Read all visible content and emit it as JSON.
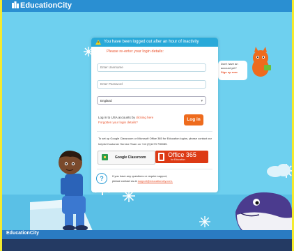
{
  "header": {
    "logo_text": "EducationCity",
    "bg_color": "#2a8fd2"
  },
  "login_card": {
    "alert_text": "You have been logged out after an hour of inactivity",
    "alert_icon": "warning-icon",
    "prompt": "Please re-enter your login details:",
    "username_placeholder": "Enter Username",
    "password_placeholder": "Enter Password",
    "region_selected": "England",
    "usa_text": "Log in to USA accounts by",
    "usa_link": "clicking here",
    "forgot_link": "Forgotten your login details?",
    "login_button": "Log in",
    "classroom_note": "To set up Google Classroom or Microsoft Office 365 for Education logins, please contact our helpful Customer Service Team on +44 (0)1473 735085.",
    "google_button": "Google Classroom",
    "office_title": "Office 365",
    "office_subtitle": "for Education",
    "help_line1": "If you have any questions or require support,",
    "help_line2_prefix": "please contact us at",
    "help_email": "support@educationcity.com."
  },
  "signup_bubble": {
    "text": "Don't have an account yet?",
    "link": "Sign up now"
  },
  "footer": {
    "logo_text": "EducationCity"
  },
  "colors": {
    "page_bg": "#6ed0ef",
    "accent": "#ee6b1d",
    "alert": "#29a9d9",
    "frame": "#f4ea2e"
  }
}
